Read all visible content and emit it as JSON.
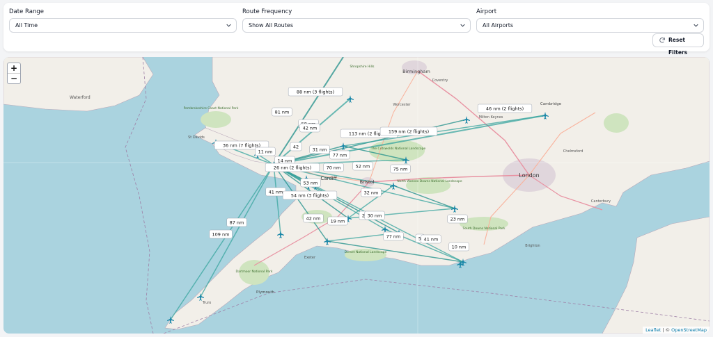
{
  "filters": {
    "date_range": {
      "label": "Date Range",
      "value": "All Time"
    },
    "route_frequency": {
      "label": "Route Frequency",
      "value": "Show All Routes"
    },
    "airport": {
      "label": "Airport",
      "value": "All Airports"
    },
    "reset_label": "Reset Filters"
  },
  "map": {
    "zoom_in": "+",
    "zoom_out": "−",
    "attribution": {
      "leaflet": "Leaflet",
      "separator": " | © ",
      "osm": "OpenStreetMap"
    },
    "place_labels": [
      "Waterford",
      "Pembrokeshire Coast National Park",
      "St Davids",
      "Shropshire Hills",
      "Birmingham",
      "Coventry",
      "Worcester",
      "Cambridge",
      "Milton Keynes",
      "Chelmsford",
      "Cardiff",
      "Bristol",
      "London",
      "Canterbury",
      "North Wessex Downs National Landscape",
      "The Cotswolds National Landscape",
      "South Downs National Park",
      "Dorset National Landscape",
      "Dartmoor National Park",
      "Plymouth",
      "Truro",
      "Brighton",
      "Exeter"
    ],
    "route_labels": [
      "88 nm (3 flights)",
      "81 nm",
      "58 nm",
      "46 nm (2 flights)",
      "113 nm (2 flights)",
      "159 nm (2 flights)",
      "36 nm (7 flights)",
      "11 nm",
      "42",
      "42 nm",
      "31 nm",
      "14 nm",
      "77 nm",
      "26 nm (2 flights)",
      "70 nm",
      "52 nm",
      "75 nm",
      "53 nm",
      "41 nm",
      "54 nm (3 flights)",
      "32 nm",
      "87 nm",
      "109 nm",
      "42 nm",
      "19 nm",
      "22",
      "30 nm",
      "23 nm",
      "77 nm",
      "5",
      "41 nm",
      "10 nm"
    ]
  }
}
